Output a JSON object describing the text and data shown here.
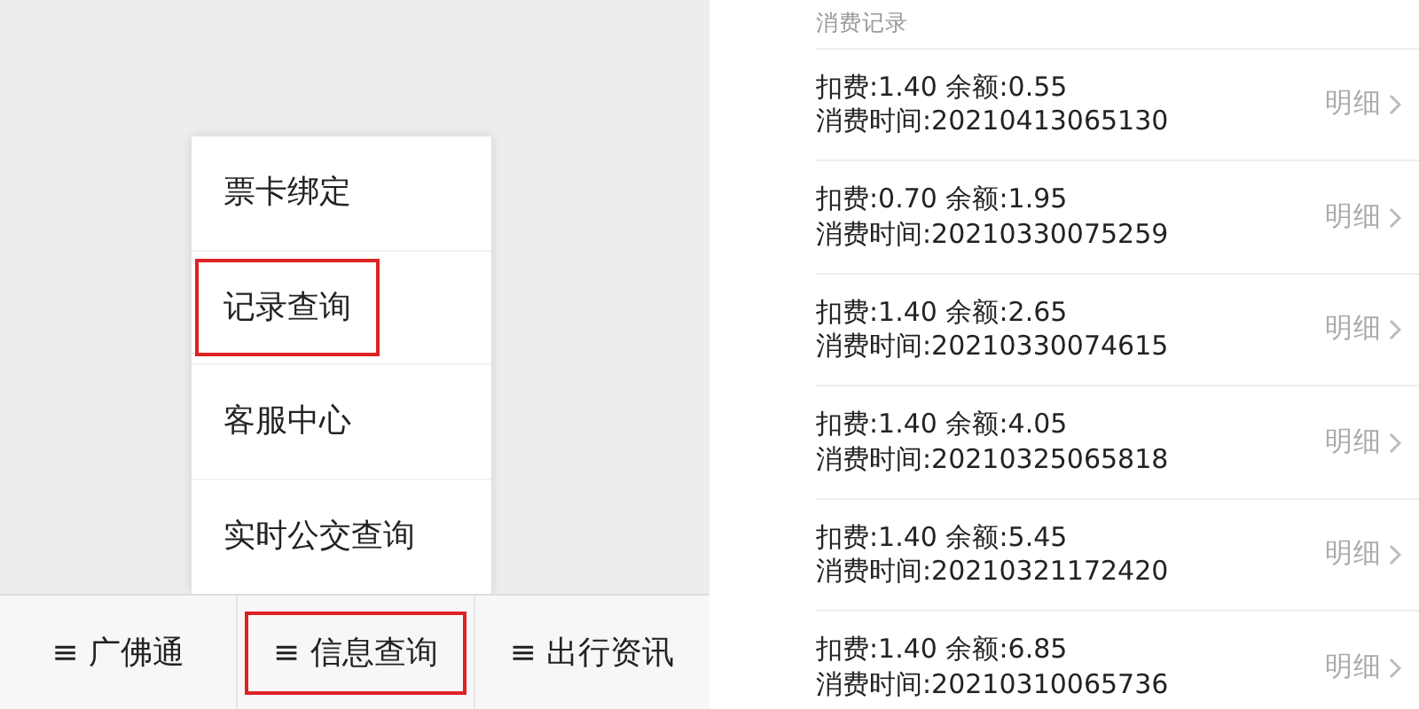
{
  "left_panel": {
    "popup_menu": [
      {
        "label": "票卡绑定",
        "highlighted": false
      },
      {
        "label": "记录查询",
        "highlighted": true
      },
      {
        "label": "客服中心",
        "highlighted": false
      },
      {
        "label": "实时公交查询",
        "highlighted": false
      }
    ],
    "bottom_tabs": [
      {
        "icon": "≡",
        "label": "广佛通",
        "highlighted": false
      },
      {
        "icon": "≡",
        "label": "信息查询",
        "highlighted": true
      },
      {
        "icon": "≡",
        "label": "出行资讯",
        "highlighted": false
      }
    ]
  },
  "right_panel": {
    "section_title": "消费记录",
    "records": [
      {
        "charge": "扣费:1.40 余额:0.55",
        "time": "消费时间:20210413065130",
        "detail": "明细"
      },
      {
        "charge": "扣费:0.70 余额:1.95",
        "time": "消费时间:20210330075259",
        "detail": "明细"
      },
      {
        "charge": "扣费:1.40 余额:2.65",
        "time": "消费时间:20210330074615",
        "detail": "明细"
      },
      {
        "charge": "扣费:1.40 余额:4.05",
        "time": "消费时间:20210325065818",
        "detail": "明细"
      },
      {
        "charge": "扣费:1.40 余额:5.45",
        "time": "消费时间:20210321172420",
        "detail": "明细"
      },
      {
        "charge": "扣费:1.40 余额:6.85",
        "time": "消费时间:20210310065736",
        "detail": "明细"
      }
    ]
  }
}
